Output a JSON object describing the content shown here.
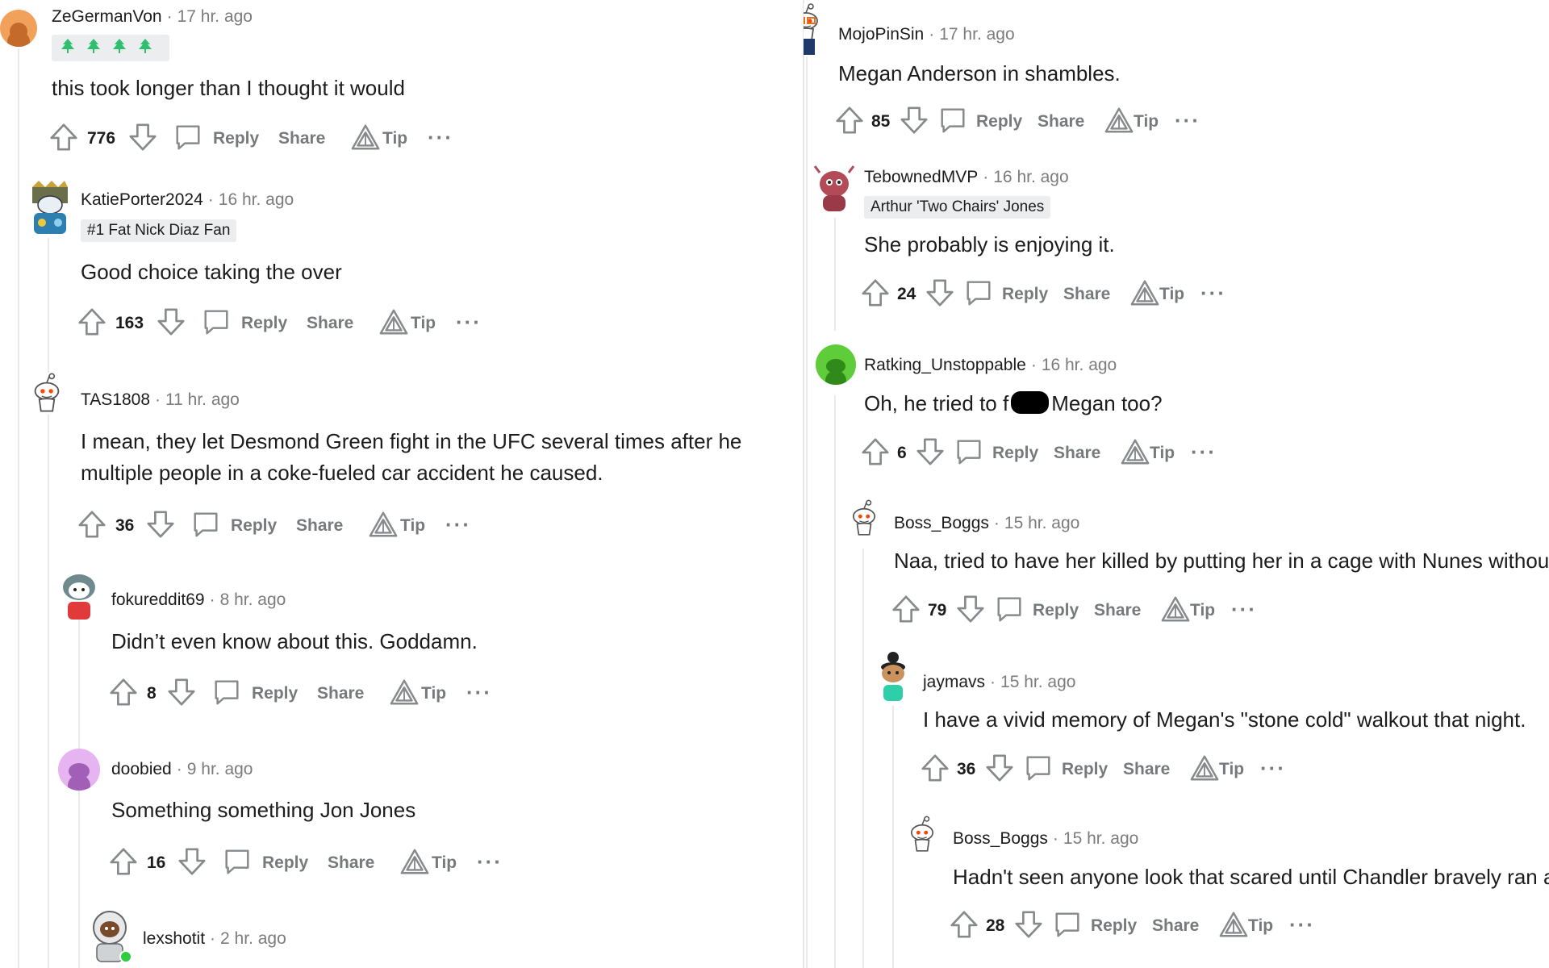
{
  "actions": {
    "reply": "Reply",
    "share": "Share",
    "tip": "Tip",
    "more": "···",
    "dot": "·"
  },
  "colors": {
    "meta_gray": "#7c7c7c",
    "action_gray": "#777a7c",
    "flair_bg": "#ebedef",
    "thread_line": "#e8eaec"
  },
  "left": {
    "c1": {
      "author": "ZeGermanVon",
      "time": "17 hr. ago",
      "flair_icons": [
        "tree-emoji",
        "tree-emoji",
        "tree-emoji",
        "tree-emoji"
      ],
      "body": "this took longer than I thought it would",
      "score": "776",
      "avatar_color": "#f2a15a"
    },
    "c2": {
      "author": "KatiePorter2024",
      "time": "16 hr. ago",
      "flair": "#1 Fat Nick Diaz Fan",
      "body": "Good choice taking the over",
      "score": "163"
    },
    "c3": {
      "author": "TAS1808",
      "time": "11 hr. ago",
      "body": "I mean, they let Desmond Green fight in the UFC several times after he\nmultiple people in a coke-fueled car accident he caused.",
      "score": "36"
    },
    "c4": {
      "author": "fokureddit69",
      "time": "8 hr. ago",
      "body": "Didn’t even know about this. Goddamn.",
      "score": "8"
    },
    "c5": {
      "author": "doobied",
      "time": "9 hr. ago",
      "body": "Something something Jon Jones",
      "score": "16",
      "avatar_color": "#e6b4f0"
    },
    "c6": {
      "author": "lexshotit",
      "time": "2 hr. ago"
    }
  },
  "right": {
    "c1": {
      "author": "MojoPinSin",
      "time": "17 hr. ago",
      "body": "Megan Anderson in shambles.",
      "score": "85"
    },
    "c2": {
      "author": "TebownedMVP",
      "time": "16 hr. ago",
      "flair": "Arthur 'Two Chairs' Jones",
      "body": "She probably is enjoying it.",
      "score": "24"
    },
    "c3": {
      "author": "Ratking_Unstoppable",
      "time": "16 hr. ago",
      "body_a": "Oh, he tried to f",
      "body_b": "Megan too?",
      "score": "6",
      "avatar_color": "#5fcc3a"
    },
    "c4": {
      "author": "Boss_Boggs",
      "time": "15 hr. ago",
      "body": "Naa, tried to have her killed by putting her in a cage with Nunes withou",
      "score": "79"
    },
    "c5": {
      "author": "jaymavs",
      "time": "15 hr. ago",
      "body": "I have a vivid memory of Megan's \"stone cold\" walkout that night.",
      "score": "36"
    },
    "c6": {
      "author": "Boss_Boggs",
      "time": "15 hr. ago",
      "body": "Hadn't seen anyone look that scared until Chandler bravely ran a",
      "score": "28"
    }
  }
}
